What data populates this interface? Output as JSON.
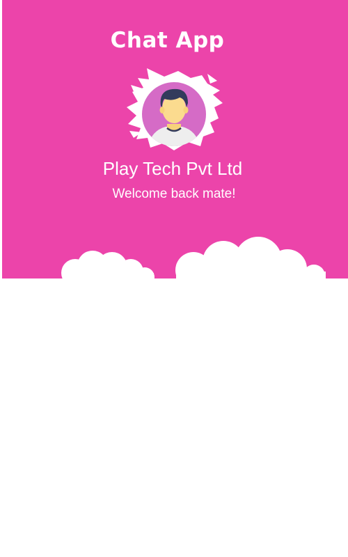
{
  "header": {
    "title": "Chat App",
    "company": "Play Tech Pvt Ltd",
    "welcome": "Welcome back mate!",
    "avatar_icon": "user-avatar-icon"
  },
  "colors": {
    "header_bg": "#ec44aa",
    "avatar_circle": "#d56bc6",
    "text": "#ffffff"
  }
}
